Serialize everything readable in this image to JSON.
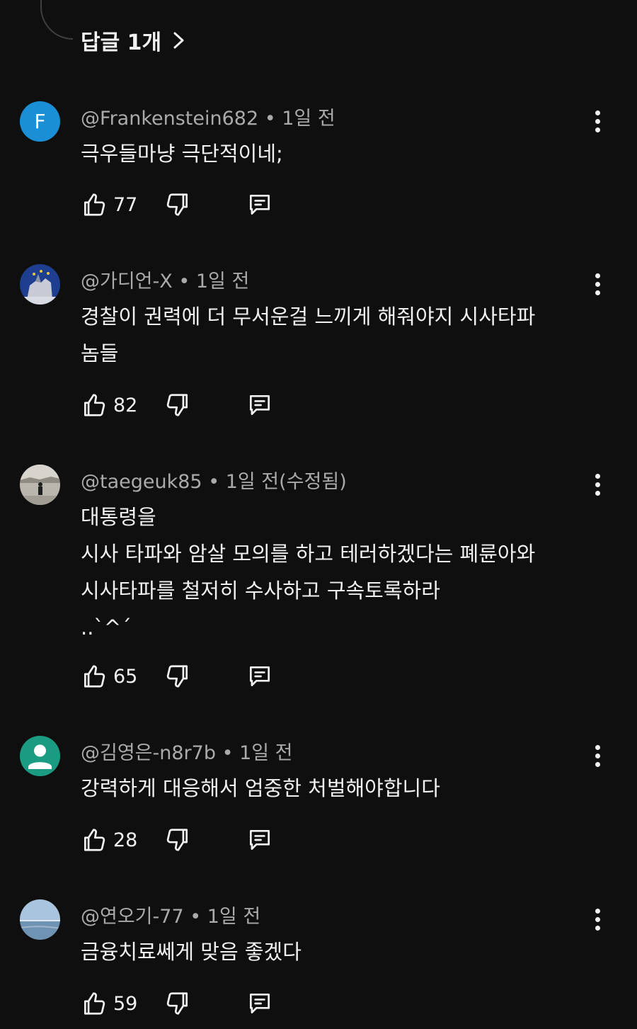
{
  "replies": {
    "label": "답글 1개"
  },
  "comments": [
    {
      "avatar_letter": "F",
      "author": "@Frankenstein682",
      "sep": " • ",
      "time": "1일 전",
      "text": "극우들마냥 극단적이네;",
      "likes": "77"
    },
    {
      "author": "@가디언-X",
      "sep": " • ",
      "time": "1일 전",
      "text": "경찰이 권력에 더 무서운걸 느끼게 해줘야지 시사타파\n놈들",
      "likes": "82"
    },
    {
      "author": "@taegeuk85",
      "sep": " • ",
      "time": "1일 전(수정됨)",
      "text": "대통령을\n시사 타파와 암살 모의를 하고 테러하겠다는 폐륜아와\n시사타파를 철저히 수사하고 구속토록하라\n..`^´",
      "likes": "65"
    },
    {
      "author": "@김영은-n8r7b",
      "sep": " • ",
      "time": "1일 전",
      "text": "강력하게 대응해서 엄중한 처벌해야합니다",
      "likes": "28"
    },
    {
      "author": "@연오기-77",
      "sep": " • ",
      "time": "1일 전",
      "text": "금융치료쎄게 맞음 좋겠다",
      "likes": "59"
    }
  ],
  "colors": {
    "background": "#0f0f0f",
    "text": "#f1f1f1",
    "meta": "#aaaaaa",
    "avatar_f": "#1a8fd6",
    "avatar_teal": "#1b9b82"
  },
  "icons": {
    "like": "thumbs-up-icon",
    "dislike": "thumbs-down-icon",
    "reply": "comment-icon",
    "more": "more-vert-icon",
    "chevron": "chevron-right-icon"
  }
}
